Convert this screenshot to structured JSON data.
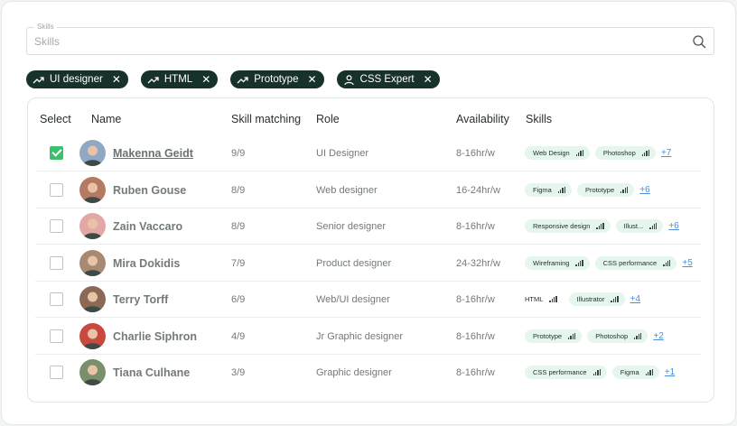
{
  "search": {
    "legend": "Skills",
    "placeholder": "Skills",
    "value": ""
  },
  "filters": [
    {
      "label": "UI designer",
      "icon": "trend-icon"
    },
    {
      "label": "HTML",
      "icon": "trend-icon"
    },
    {
      "label": "Prototype",
      "icon": "trend-icon"
    },
    {
      "label": "CSS Expert",
      "icon": "user-icon"
    }
  ],
  "table": {
    "headers": {
      "select": "Select",
      "name": "Name",
      "match": "Skill matching",
      "role": "Role",
      "availability": "Availability",
      "skills": "Skills"
    },
    "rows": [
      {
        "checked": true,
        "name": "Makenna Geidt",
        "match": "9/9",
        "role": "UI Designer",
        "availability": "8-16hr/w",
        "skills": [
          "Web Design",
          "Photoshop"
        ],
        "more": "+7",
        "avatar_color": "#8fa9c4"
      },
      {
        "checked": false,
        "name": "Ruben Gouse",
        "match": "8/9",
        "role": "Web designer",
        "availability": "16-24hr/w",
        "skills": [
          "Figma",
          "Prototype"
        ],
        "more": "+6",
        "avatar_color": "#b47a62"
      },
      {
        "checked": false,
        "name": "Zain Vaccaro",
        "match": "8/9",
        "role": "Senior designer",
        "availability": "8-16hr/w",
        "skills": [
          "Responsive design",
          "Illust..."
        ],
        "more": "+6",
        "avatar_color": "#e2a8a6"
      },
      {
        "checked": false,
        "name": "Mira Dokidis",
        "match": "7/9",
        "role": "Product designer",
        "availability": "24-32hr/w",
        "skills": [
          "Wireframing",
          "CSS performance"
        ],
        "more": "+5",
        "avatar_color": "#a88a72"
      },
      {
        "checked": false,
        "name": "Terry Torff",
        "match": "6/9",
        "role": "Web/UI designer",
        "availability": "8-16hr/w",
        "skills": [
          "HTML",
          "Illustrator"
        ],
        "more": "+4",
        "avatar_color": "#8a6a55"
      },
      {
        "checked": false,
        "name": "Charlie Siphron",
        "match": "4/9",
        "role": "Jr Graphic designer",
        "availability": "8-16hr/w",
        "skills": [
          "Prototype",
          "Photoshop"
        ],
        "more": "+2",
        "avatar_color": "#c84a3e"
      },
      {
        "checked": false,
        "name": "Tiana Culhane",
        "match": "3/9",
        "role": "Graphic designer",
        "availability": "8-16hr/w",
        "skills": [
          "CSS performance",
          "Figma"
        ],
        "more": "+1",
        "avatar_color": "#7b8f6c"
      }
    ]
  },
  "colors": {
    "chip_bg": "#17312b",
    "checkbox_checked": "#3bc16d",
    "skill_bg": "#e5f6ec",
    "link": "#4a8fd8"
  }
}
